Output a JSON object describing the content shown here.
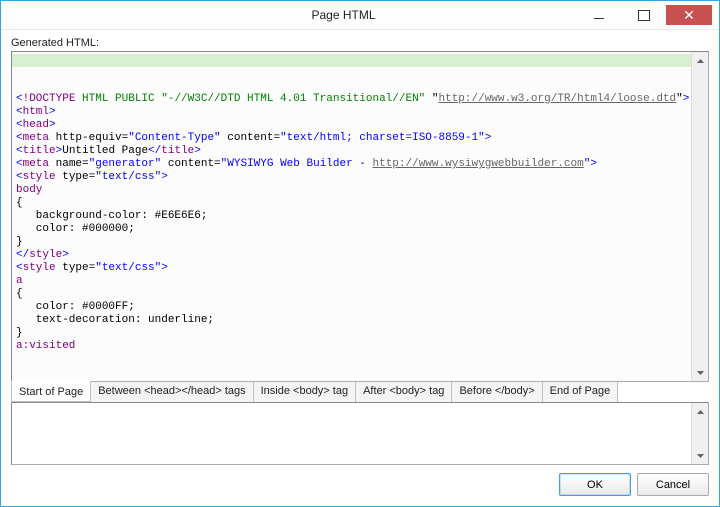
{
  "window": {
    "title": "Page HTML"
  },
  "label": "Generated HTML:",
  "code": {
    "lines": [
      [
        {
          "cls": "t-blue",
          "text": "<"
        },
        {
          "cls": "t-purple",
          "text": "!DOCTYPE"
        },
        {
          "cls": "t-green",
          "text": " HTML PUBLIC \"-//W3C//DTD HTML 4.01 Transitional//EN\" "
        },
        {
          "cls": "",
          "text": "\""
        },
        {
          "cls": "t-link",
          "text": "http://www.w3.org/TR/html4/loose.dtd"
        },
        {
          "cls": "",
          "text": "\""
        },
        {
          "cls": "t-blue",
          "text": ">"
        }
      ],
      [
        {
          "cls": "t-blue",
          "text": "<"
        },
        {
          "cls": "t-purple",
          "text": "html"
        },
        {
          "cls": "t-blue",
          "text": ">"
        }
      ],
      [
        {
          "cls": "t-blue",
          "text": "<"
        },
        {
          "cls": "t-purple",
          "text": "head"
        },
        {
          "cls": "t-blue",
          "text": ">"
        }
      ],
      [
        {
          "cls": "t-blue",
          "text": "<"
        },
        {
          "cls": "t-purple",
          "text": "meta"
        },
        {
          "cls": "",
          "text": " http-equiv="
        },
        {
          "cls": "t-blue",
          "text": "\"Content-Type\""
        },
        {
          "cls": "",
          "text": " content="
        },
        {
          "cls": "t-blue",
          "text": "\"text/html; charset=ISO-8859-1\""
        },
        {
          "cls": "t-blue",
          "text": ">"
        }
      ],
      [
        {
          "cls": "t-blue",
          "text": "<"
        },
        {
          "cls": "t-purple",
          "text": "title"
        },
        {
          "cls": "t-blue",
          "text": ">"
        },
        {
          "cls": "",
          "text": "Untitled Page"
        },
        {
          "cls": "t-blue",
          "text": "</"
        },
        {
          "cls": "t-purple",
          "text": "title"
        },
        {
          "cls": "t-blue",
          "text": ">"
        }
      ],
      [
        {
          "cls": "t-blue",
          "text": "<"
        },
        {
          "cls": "t-purple",
          "text": "meta"
        },
        {
          "cls": "",
          "text": " name="
        },
        {
          "cls": "t-blue",
          "text": "\"generator\""
        },
        {
          "cls": "",
          "text": " content="
        },
        {
          "cls": "t-blue",
          "text": "\"WYSIWYG Web Builder - "
        },
        {
          "cls": "t-link",
          "text": "http://www.wysiwygwebbuilder.com"
        },
        {
          "cls": "t-blue",
          "text": "\""
        },
        {
          "cls": "t-blue",
          "text": ">"
        }
      ],
      [
        {
          "cls": "t-blue",
          "text": "<"
        },
        {
          "cls": "t-purple",
          "text": "style"
        },
        {
          "cls": "",
          "text": " type="
        },
        {
          "cls": "t-blue",
          "text": "\"text/css\""
        },
        {
          "cls": "t-blue",
          "text": ">"
        }
      ],
      [
        {
          "cls": "t-purple",
          "text": "body"
        }
      ],
      [
        {
          "cls": "",
          "text": "{"
        }
      ],
      [
        {
          "cls": "",
          "text": "   background-color: #E6E6E6;"
        }
      ],
      [
        {
          "cls": "",
          "text": "   color: #000000;"
        }
      ],
      [
        {
          "cls": "",
          "text": "}"
        }
      ],
      [
        {
          "cls": "t-blue",
          "text": "</"
        },
        {
          "cls": "t-purple",
          "text": "style"
        },
        {
          "cls": "t-blue",
          "text": ">"
        }
      ],
      [
        {
          "cls": "t-blue",
          "text": "<"
        },
        {
          "cls": "t-purple",
          "text": "style"
        },
        {
          "cls": "",
          "text": " type="
        },
        {
          "cls": "t-blue",
          "text": "\"text/css\""
        },
        {
          "cls": "t-blue",
          "text": ">"
        }
      ],
      [
        {
          "cls": "t-purple",
          "text": "a"
        }
      ],
      [
        {
          "cls": "",
          "text": "{"
        }
      ],
      [
        {
          "cls": "",
          "text": "   color: #0000FF;"
        }
      ],
      [
        {
          "cls": "",
          "text": "   text-decoration: underline;"
        }
      ],
      [
        {
          "cls": "",
          "text": "}"
        }
      ],
      [
        {
          "cls": "t-purple",
          "text": "a:visited"
        }
      ]
    ]
  },
  "tabs": [
    {
      "label": "Start of Page",
      "active": true
    },
    {
      "label": "Between <head></head> tags",
      "active": false
    },
    {
      "label": "Inside <body> tag",
      "active": false
    },
    {
      "label": "After <body> tag",
      "active": false
    },
    {
      "label": "Before </body>",
      "active": false
    },
    {
      "label": "End of Page",
      "active": false
    }
  ],
  "buttons": {
    "ok": "OK",
    "cancel": "Cancel"
  }
}
